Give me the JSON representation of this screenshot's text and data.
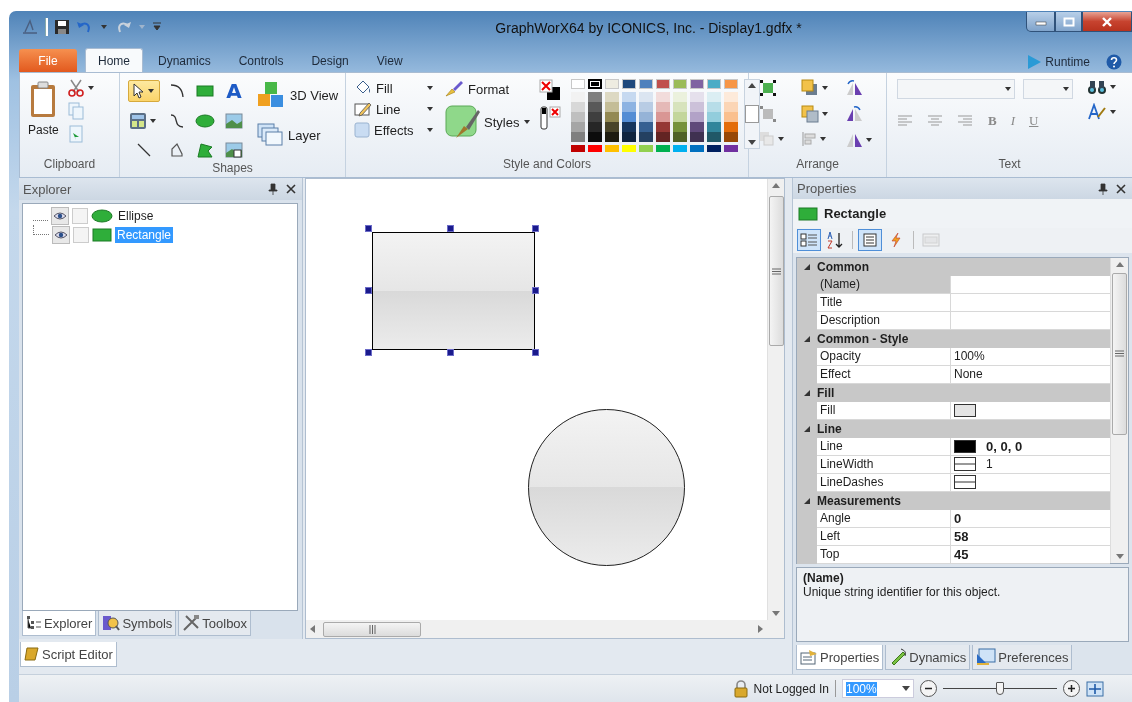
{
  "window": {
    "title": "GraphWorX64 by ICONICS, Inc. - Display1.gdfx *"
  },
  "ribbon": {
    "file_tab": "File",
    "tabs": [
      {
        "label": "Home",
        "selected": true
      },
      {
        "label": "Dynamics",
        "selected": false
      },
      {
        "label": "Controls",
        "selected": false
      },
      {
        "label": "Design",
        "selected": false
      },
      {
        "label": "View",
        "selected": false
      }
    ],
    "runtime": "Runtime",
    "clipboard": {
      "paste": "Paste",
      "label": "Clipboard"
    },
    "shapes": {
      "tools": [
        {
          "kind": "pointer",
          "selected": true
        },
        {
          "kind": "arc",
          "selected": false
        },
        {
          "kind": "rectangle",
          "selected": false
        },
        {
          "kind": "text",
          "label": "A",
          "selected": false
        },
        {
          "kind": "table",
          "selected": false
        },
        {
          "kind": "curve",
          "selected": false
        },
        {
          "kind": "ellipse",
          "selected": false
        },
        {
          "kind": "image",
          "selected": false
        },
        {
          "kind": "line",
          "selected": false
        },
        {
          "kind": "polygon",
          "selected": false
        },
        {
          "kind": "freeform",
          "selected": false
        },
        {
          "kind": "picture",
          "selected": false
        }
      ],
      "view3d": "3D View",
      "layer": "Layer",
      "label": "Shapes"
    },
    "style": {
      "fill": "Fill",
      "line": "Line",
      "effects": "Effects",
      "format": "Format",
      "styles": "Styles",
      "label": "Style and Colors",
      "theme": [
        {
          "color": "#ffffff",
          "selected": false,
          "shades": [
            {
              "color": "#f2f2f2"
            },
            {
              "color": "#d8d8d8"
            },
            {
              "color": "#bfbfbf"
            },
            {
              "color": "#a5a5a5"
            },
            {
              "color": "#7f7f7f"
            }
          ]
        },
        {
          "color": "#000000",
          "selected": true,
          "shades": [
            {
              "color": "#7f7f7f"
            },
            {
              "color": "#595959"
            },
            {
              "color": "#3f3f3f"
            },
            {
              "color": "#262626"
            },
            {
              "color": "#0c0c0c"
            }
          ]
        },
        {
          "color": "#eeece1",
          "selected": false,
          "shades": [
            {
              "color": "#ddd9c3"
            },
            {
              "color": "#c4bd97"
            },
            {
              "color": "#938953"
            },
            {
              "color": "#494429"
            },
            {
              "color": "#1d1b10"
            }
          ]
        },
        {
          "color": "#1f497d",
          "selected": false,
          "shades": [
            {
              "color": "#c6d9f0"
            },
            {
              "color": "#8db3e2"
            },
            {
              "color": "#548dd4"
            },
            {
              "color": "#17365d"
            },
            {
              "color": "#0f243e"
            }
          ]
        },
        {
          "color": "#4f81bd",
          "selected": false,
          "shades": [
            {
              "color": "#dbe5f1"
            },
            {
              "color": "#b8cce4"
            },
            {
              "color": "#95b3d7"
            },
            {
              "color": "#366092"
            },
            {
              "color": "#244061"
            }
          ]
        },
        {
          "color": "#c0504d",
          "selected": false,
          "shades": [
            {
              "color": "#f2dcdb"
            },
            {
              "color": "#e5b9b7"
            },
            {
              "color": "#d99694"
            },
            {
              "color": "#953734"
            },
            {
              "color": "#632423"
            }
          ]
        },
        {
          "color": "#9bbb59",
          "selected": false,
          "shades": [
            {
              "color": "#ebf1dd"
            },
            {
              "color": "#d7e3bc"
            },
            {
              "color": "#c3d69b"
            },
            {
              "color": "#76923c"
            },
            {
              "color": "#4f6128"
            }
          ]
        },
        {
          "color": "#8064a2",
          "selected": false,
          "shades": [
            {
              "color": "#e5e0ec"
            },
            {
              "color": "#ccc1d9"
            },
            {
              "color": "#b2a2c7"
            },
            {
              "color": "#5f497a"
            },
            {
              "color": "#3f3151"
            }
          ]
        },
        {
          "color": "#4bacc6",
          "selected": false,
          "shades": [
            {
              "color": "#dbeef3"
            },
            {
              "color": "#b7dde8"
            },
            {
              "color": "#92cddc"
            },
            {
              "color": "#31859b"
            },
            {
              "color": "#205867"
            }
          ]
        },
        {
          "color": "#f79646",
          "selected": false,
          "shades": [
            {
              "color": "#fdeada"
            },
            {
              "color": "#fbd5b5"
            },
            {
              "color": "#fac08f"
            },
            {
              "color": "#e36c09"
            },
            {
              "color": "#974806"
            }
          ]
        }
      ],
      "standard": [
        {
          "color": "#c00000"
        },
        {
          "color": "#ff0000"
        },
        {
          "color": "#ffc000"
        },
        {
          "color": "#ffff00"
        },
        {
          "color": "#92d050"
        },
        {
          "color": "#00b050"
        },
        {
          "color": "#00b0f0"
        },
        {
          "color": "#0070c0"
        },
        {
          "color": "#002060"
        },
        {
          "color": "#7030a0"
        }
      ]
    },
    "arrange": {
      "label": "Arrange"
    },
    "text": {
      "format_buttons": [
        "B",
        "I",
        "U"
      ],
      "label": "Text"
    }
  },
  "explorer": {
    "title": "Explorer",
    "items": [
      {
        "label": "Ellipse",
        "kind": "ellipse",
        "locked": false,
        "selected": false
      },
      {
        "label": "Rectangle",
        "kind": "rectangle",
        "locked": false,
        "selected": true
      }
    ],
    "tabs": [
      {
        "label": "Explorer",
        "selected": true
      },
      {
        "label": "Symbols",
        "selected": false
      },
      {
        "label": "Toolbox",
        "selected": false
      }
    ]
  },
  "script_editor": "Script Editor",
  "canvas": {
    "shapes": [
      {
        "kind": "rectangle",
        "selected": true
      },
      {
        "kind": "ellipse",
        "selected": false
      }
    ]
  },
  "properties": {
    "title": "Properties",
    "object": "Rectangle",
    "toolbar": [
      {
        "kind": "categorized",
        "selected": true,
        "disabled": false
      },
      {
        "kind": "alphabetical",
        "selected": false,
        "disabled": false
      },
      {
        "kind": "properties",
        "selected": true,
        "disabled": false
      },
      {
        "kind": "events",
        "selected": false,
        "disabled": false
      },
      {
        "kind": "pages",
        "selected": false,
        "disabled": true
      }
    ],
    "categories": [
      {
        "name": "Common",
        "expanded": true,
        "rows": [
          {
            "name": "(Name)",
            "kind": "text",
            "selected": true
          },
          {
            "name": "Title",
            "kind": "text",
            "selected": false
          },
          {
            "name": "Description",
            "kind": "text",
            "selected": false
          }
        ]
      },
      {
        "name": "Common - Style",
        "expanded": true,
        "rows": [
          {
            "name": "Opacity",
            "kind": "text",
            "value": "100%",
            "bold": false,
            "selected": false
          },
          {
            "name": "Effect",
            "kind": "text",
            "value": "None",
            "bold": false,
            "selected": false
          }
        ]
      },
      {
        "name": "Fill",
        "expanded": true,
        "rows": [
          {
            "name": "Fill",
            "kind": "color",
            "color": "#e4e4e4",
            "selected": false
          }
        ]
      },
      {
        "name": "Line",
        "expanded": true,
        "rows": [
          {
            "name": "Line",
            "kind": "color",
            "color": "#000000",
            "value": "0, 0, 0",
            "bold": true,
            "selected": false
          },
          {
            "name": "LineWidth",
            "kind": "stroke",
            "value": "1",
            "bold": false,
            "selected": false
          },
          {
            "name": "LineDashes",
            "kind": "stroke",
            "selected": false
          }
        ]
      },
      {
        "name": "Measurements",
        "expanded": true,
        "rows": [
          {
            "name": "Angle",
            "kind": "text",
            "value": "0",
            "bold": true,
            "selected": false
          },
          {
            "name": "Left",
            "kind": "text",
            "value": "58",
            "bold": true,
            "selected": false
          },
          {
            "name": "Top",
            "kind": "text",
            "value": "45",
            "bold": true,
            "selected": false
          }
        ]
      }
    ],
    "description": {
      "title": "(Name)",
      "text": "Unique string identifier for this object."
    },
    "tabs": [
      {
        "label": "Properties",
        "selected": true
      },
      {
        "label": "Dynamics",
        "selected": false
      },
      {
        "label": "Preferences",
        "selected": false
      }
    ]
  },
  "status_bar": {
    "login": "Not Logged In",
    "zoom": "100%",
    "zoom_slider": {
      "level": 0.5
    }
  }
}
